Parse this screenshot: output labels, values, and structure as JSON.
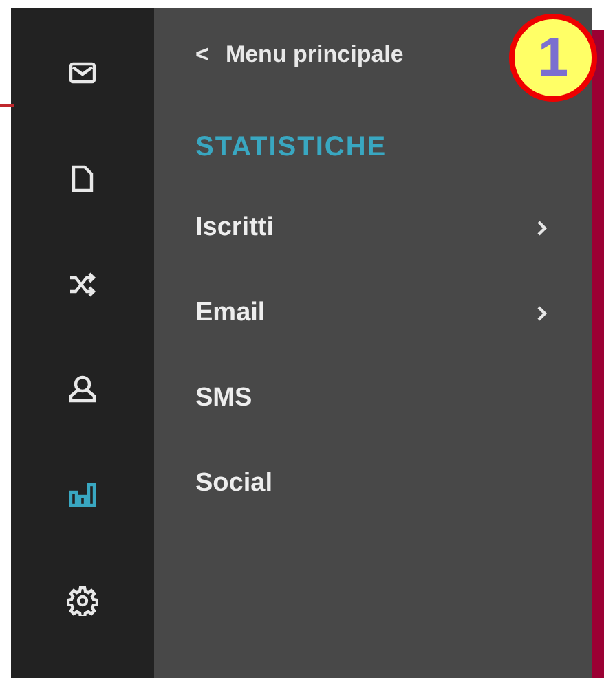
{
  "rail": [
    {
      "kind": "mail",
      "selected": false
    },
    {
      "kind": "document",
      "selected": false
    },
    {
      "kind": "shuffle",
      "selected": false
    },
    {
      "kind": "user",
      "selected": false
    },
    {
      "kind": "chart",
      "selected": true
    },
    {
      "kind": "settings",
      "selected": false
    }
  ],
  "back_link": {
    "arrow": "<",
    "label": "Menu principale"
  },
  "section_title": "STATISTICHE",
  "menu": [
    {
      "label": "Iscritti",
      "has_submenu": true
    },
    {
      "label": "Email",
      "has_submenu": true
    },
    {
      "label": "SMS",
      "has_submenu": false
    },
    {
      "label": "Social",
      "has_submenu": false
    }
  ],
  "callout": "1"
}
